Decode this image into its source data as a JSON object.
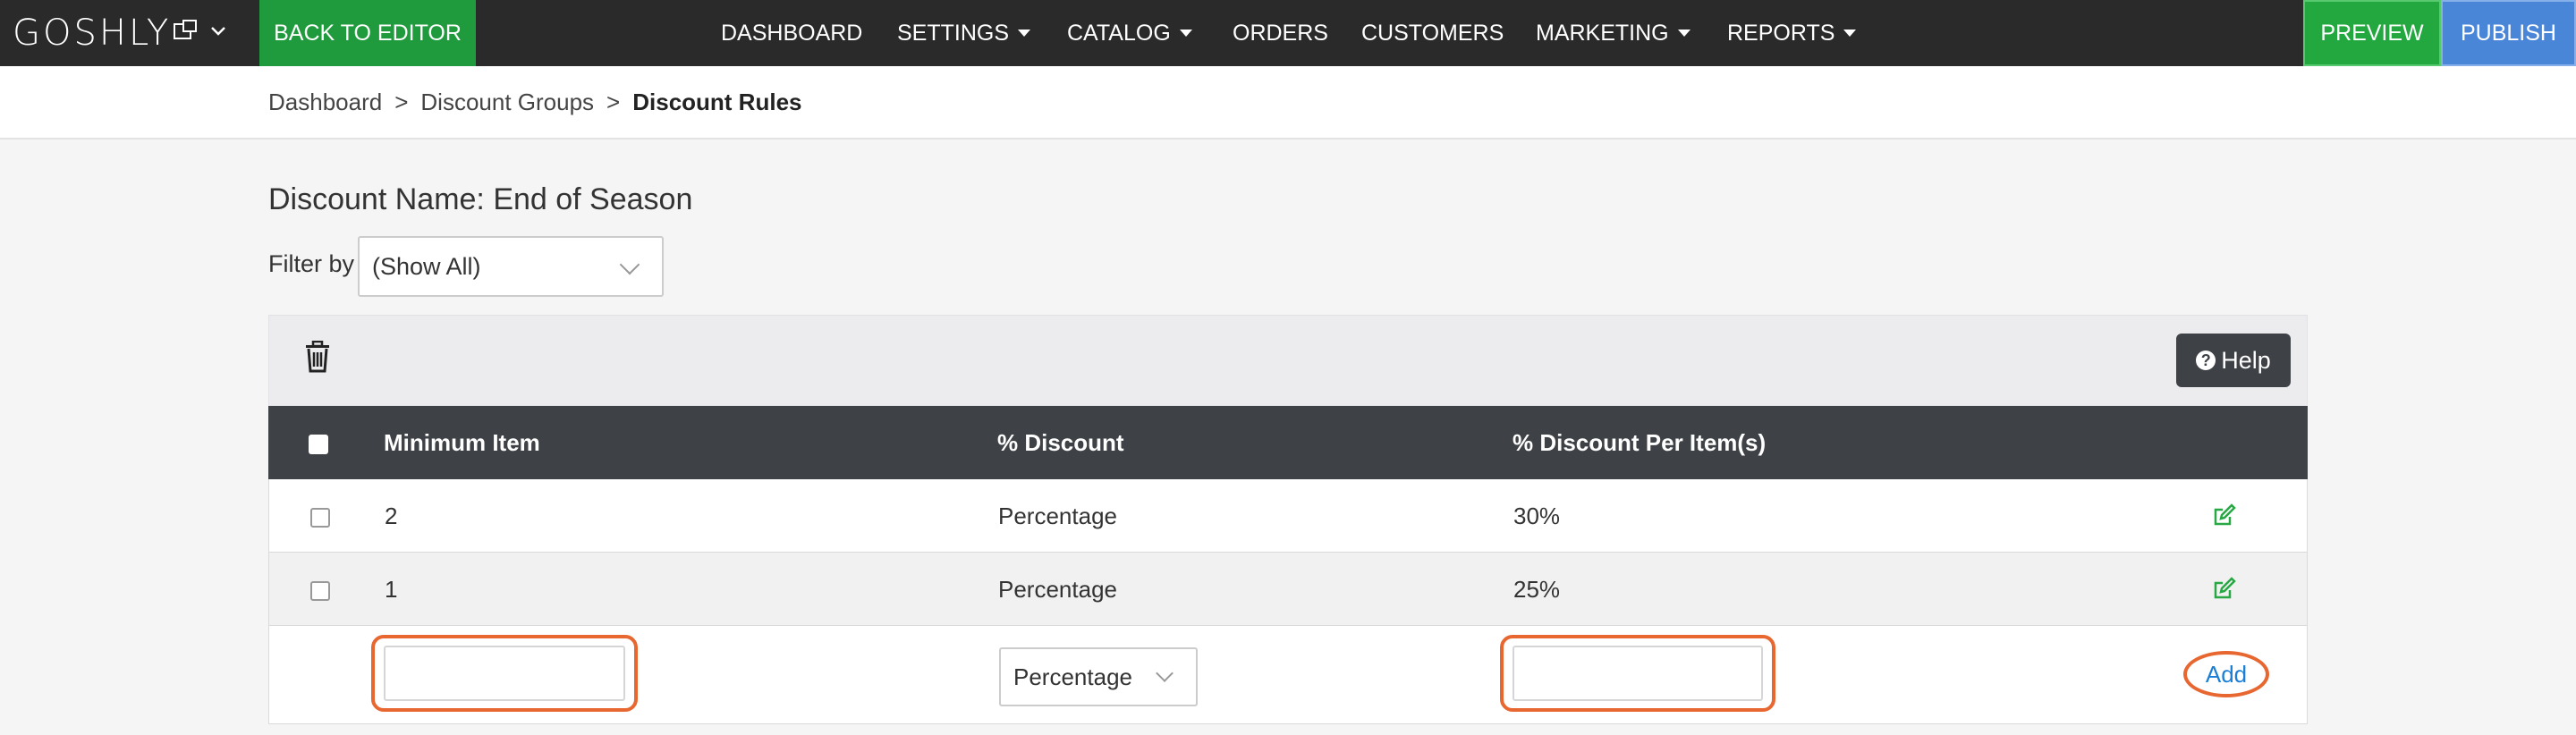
{
  "nav": {
    "logo_text": "GOSHLY",
    "back_to_editor": "BACK TO EDITOR",
    "items": [
      {
        "label": "DASHBOARD",
        "has_caret": false
      },
      {
        "label": "SETTINGS",
        "has_caret": true
      },
      {
        "label": "CATALOG",
        "has_caret": true
      },
      {
        "label": "ORDERS",
        "has_caret": false
      },
      {
        "label": "CUSTOMERS",
        "has_caret": false
      },
      {
        "label": "MARKETING",
        "has_caret": true
      },
      {
        "label": "REPORTS",
        "has_caret": true
      }
    ],
    "preview": "PREVIEW",
    "publish": "PUBLISH"
  },
  "breadcrumb": {
    "items": [
      "Dashboard",
      "Discount Groups"
    ],
    "current": "Discount Rules",
    "separator": ">"
  },
  "main": {
    "discount_title": "Discount Name: End of Season",
    "filter_label": "Filter by",
    "filter_value": "(Show All)",
    "help_label": "Help",
    "columns": [
      "Minimum Item",
      "% Discount",
      "% Discount Per Item(s)"
    ],
    "rows": [
      {
        "min_item": "2",
        "discount_type": "Percentage",
        "per_item": "30%"
      },
      {
        "min_item": "1",
        "discount_type": "Percentage",
        "per_item": "25%"
      }
    ],
    "new_row": {
      "min_item_value": "",
      "discount_type": "Percentage",
      "per_item_value": "",
      "add_label": "Add"
    }
  },
  "colors": {
    "navbar": "#2a2a2a",
    "back_to_editor": "#1f9a3c",
    "preview": "#22a83e",
    "publish": "#4a86d8",
    "table_header": "#3e4246",
    "highlight": "#e8662f",
    "edit_icon": "#28a745",
    "link": "#1a7fd6"
  },
  "icons": {
    "delete": "trash-icon",
    "help": "question-circle-icon",
    "edit": "edit-icon",
    "dropdown": "chevron-down-icon"
  }
}
